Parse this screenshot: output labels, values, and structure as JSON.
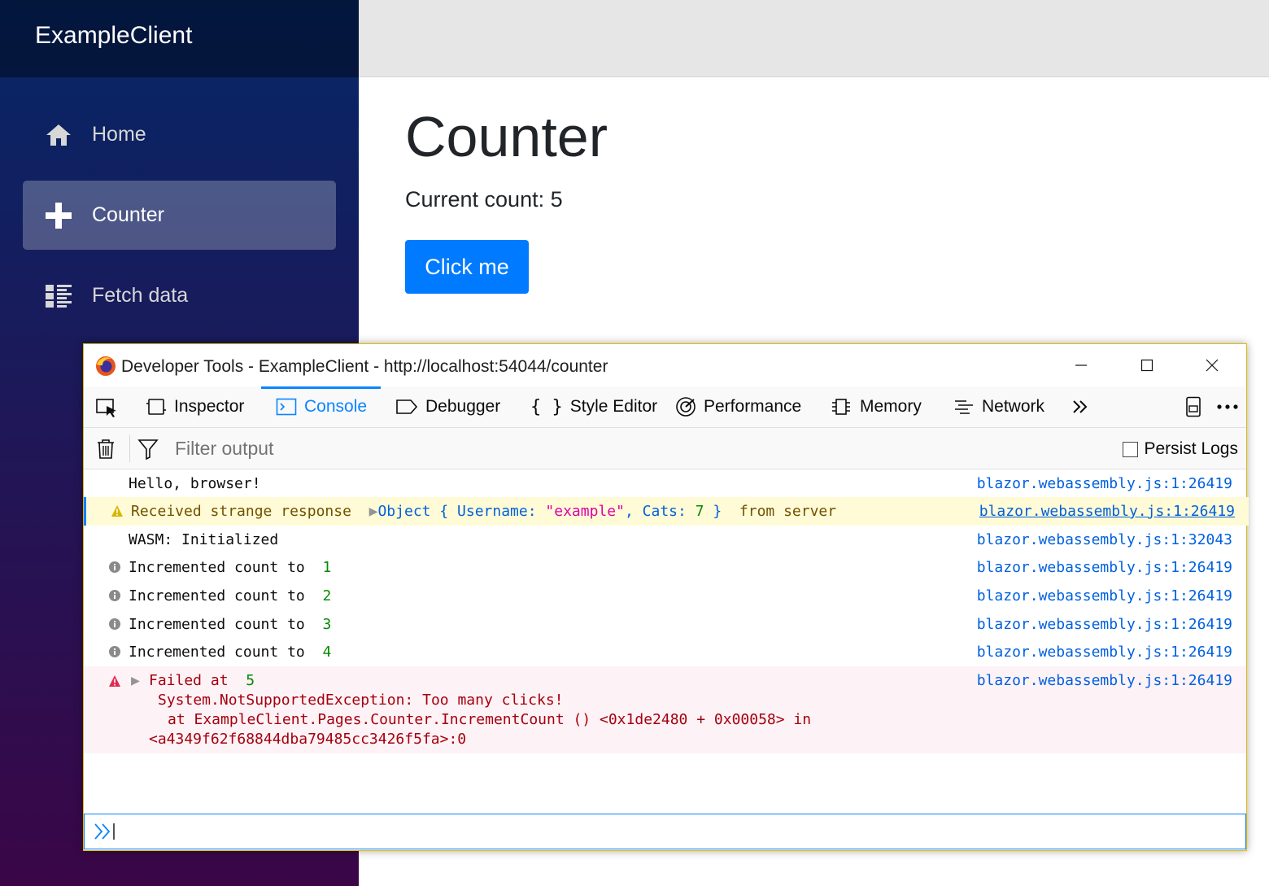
{
  "app": {
    "brand": "ExampleClient",
    "nav": [
      {
        "label": "Home",
        "icon": "home-icon"
      },
      {
        "label": "Counter",
        "icon": "plus-icon",
        "active": true
      },
      {
        "label": "Fetch data",
        "icon": "list-rich-icon"
      }
    ],
    "page_title": "Counter",
    "current_count_text": "Current count: 5",
    "button_label": "Click me",
    "colors": {
      "button": "#007bff",
      "sidebar_top": "#052767",
      "sidebar_bottom": "#3a0647"
    }
  },
  "devtools": {
    "window_title": "Developer Tools - ExampleClient - http://localhost:54044/counter",
    "tabs": [
      {
        "label": "Inspector",
        "icon": "inspector-icon"
      },
      {
        "label": "Console",
        "icon": "console-icon",
        "active": true
      },
      {
        "label": "Debugger",
        "icon": "debugger-icon"
      },
      {
        "label": "Style Editor",
        "icon": "braces-icon"
      },
      {
        "label": "Performance",
        "icon": "performance-icon"
      },
      {
        "label": "Memory",
        "icon": "memory-icon"
      },
      {
        "label": "Network",
        "icon": "network-icon"
      }
    ],
    "filter_placeholder": "Filter output",
    "persist_logs_label": "Persist Logs",
    "logs": [
      {
        "type": "log",
        "text": "Hello, browser!",
        "source": "blazor.webassembly.js:1:26419"
      },
      {
        "type": "warn",
        "text": "Received strange response",
        "object_prefix": "Object {",
        "key1": "Username:",
        "value1": "\"example\"",
        "comma": ",",
        "key2": "Cats:",
        "value2": "7",
        "object_suffix": "}",
        "suffix": "from server",
        "source": "blazor.webassembly.js:1:26419"
      },
      {
        "type": "log",
        "text": "WASM: Initialized",
        "source": "blazor.webassembly.js:1:32043"
      },
      {
        "type": "info",
        "text": "Incremented count to",
        "value": "1",
        "source": "blazor.webassembly.js:1:26419"
      },
      {
        "type": "info",
        "text": "Incremented count to",
        "value": "2",
        "source": "blazor.webassembly.js:1:26419"
      },
      {
        "type": "info",
        "text": "Incremented count to",
        "value": "3",
        "source": "blazor.webassembly.js:1:26419"
      },
      {
        "type": "info",
        "text": "Incremented count to",
        "value": "4",
        "source": "blazor.webassembly.js:1:26419"
      },
      {
        "type": "error",
        "text": "Failed at",
        "value": "5",
        "stack1": "System.NotSupportedException: Too many clicks!",
        "stack2": "at ExampleClient.Pages.Counter.IncrementCount () <0x1de2480 + 0x00058> in",
        "stack3": "<a4349f62f68844dba79485cc3426f5fa>:0",
        "source": "blazor.webassembly.js:1:26419"
      }
    ]
  }
}
